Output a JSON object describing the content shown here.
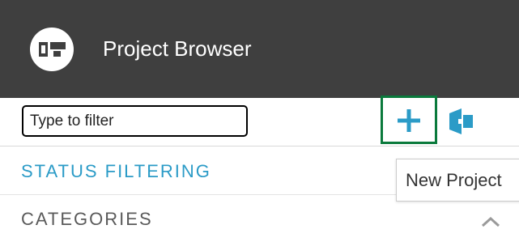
{
  "header": {
    "title": "Project Browser",
    "logo_icon": "project-browser-logo-icon"
  },
  "toolbar": {
    "filter": {
      "placeholder": "Type to filter",
      "value": ""
    },
    "new_project_icon": "plus-icon",
    "import_icon": "import-project-icon"
  },
  "sections": {
    "status_filtering": "STATUS FILTERING",
    "categories": "CATEGORIES",
    "categories_chevron_icon": "chevron-up-icon"
  },
  "tooltip": {
    "text": "New Project"
  },
  "colors": {
    "header_bg": "#3f3f3f",
    "accent_blue": "#2b9bc7",
    "highlight_green": "#0a7a3c",
    "section_gray": "#5a5a5a"
  }
}
